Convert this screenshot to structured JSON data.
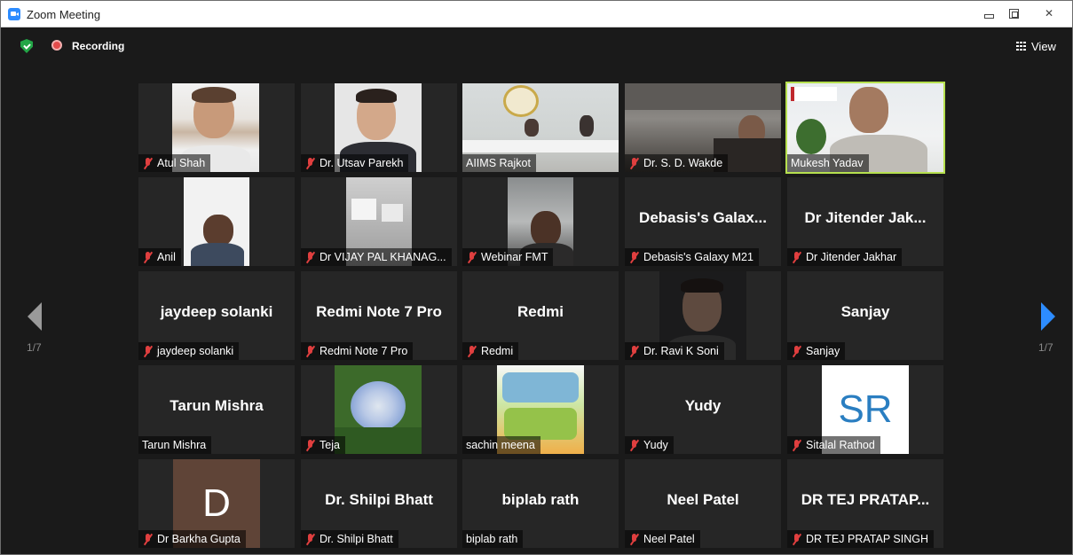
{
  "window": {
    "title": "Zoom Meeting"
  },
  "status": {
    "recording_label": "Recording"
  },
  "toolbar": {
    "view_label": "View"
  },
  "pagination": {
    "left": "1/7",
    "right": "1/7"
  },
  "participants": [
    {
      "name": "Atul Shah",
      "muted": true,
      "video": true
    },
    {
      "name": "Dr. Utsav Parekh",
      "muted": true,
      "video": true
    },
    {
      "name": "AIIMS Rajkot",
      "muted": false,
      "video": true
    },
    {
      "name": "Dr. S. D. Wakde",
      "muted": true,
      "video": true
    },
    {
      "name": "Mukesh Yadav",
      "muted": false,
      "video": true,
      "active_speaker": true
    },
    {
      "name": "Anil",
      "muted": true,
      "video": true
    },
    {
      "name": "Dr VIJAY PAL KHANAG...",
      "muted": true,
      "video": true
    },
    {
      "name": "Webinar FMT",
      "muted": true,
      "video": true
    },
    {
      "name": "Debasis's Galaxy M21",
      "display": "Debasis's Galax...",
      "muted": true,
      "video": false
    },
    {
      "name": "Dr Jitender Jakhar",
      "display": "Dr Jitender Jak...",
      "muted": true,
      "video": false
    },
    {
      "name": "jaydeep solanki",
      "display": "jaydeep solanki",
      "muted": true,
      "video": false
    },
    {
      "name": "Redmi Note 7 Pro",
      "display": "Redmi Note 7 Pro",
      "muted": true,
      "video": false
    },
    {
      "name": "Redmi",
      "display": "Redmi",
      "muted": true,
      "video": false
    },
    {
      "name": "Dr. Ravi K Soni",
      "muted": true,
      "video": true
    },
    {
      "name": "Sanjay",
      "display": "Sanjay",
      "muted": true,
      "video": false
    },
    {
      "name": "Tarun Mishra",
      "display": "Tarun Mishra",
      "muted": false,
      "video": false
    },
    {
      "name": "Teja",
      "muted": true,
      "video": true
    },
    {
      "name": "sachin meena",
      "muted": false,
      "video": true
    },
    {
      "name": "Yudy",
      "display": "Yudy",
      "muted": true,
      "video": false
    },
    {
      "name": "Sitalal Rathod",
      "initials": "SR",
      "muted": true,
      "video": true
    },
    {
      "name": "Dr Barkha Gupta",
      "initials": "D",
      "muted": true,
      "video": true
    },
    {
      "name": "Dr. Shilpi Bhatt",
      "display": "Dr. Shilpi Bhatt",
      "muted": true,
      "video": false
    },
    {
      "name": "biplab rath",
      "display": "biplab rath",
      "muted": false,
      "video": false
    },
    {
      "name": "Neel Patel",
      "display": "Neel Patel",
      "muted": true,
      "video": false
    },
    {
      "name": "DR TEJ PRATAP SINGH",
      "display": "DR TEJ PRATAP...",
      "muted": true,
      "video": false
    }
  ],
  "colors": {
    "active_speaker_border": "#b6e04f",
    "muted_icon": "#e03f3f",
    "next_arrow": "#2d8cff",
    "shield": "#23a647"
  }
}
